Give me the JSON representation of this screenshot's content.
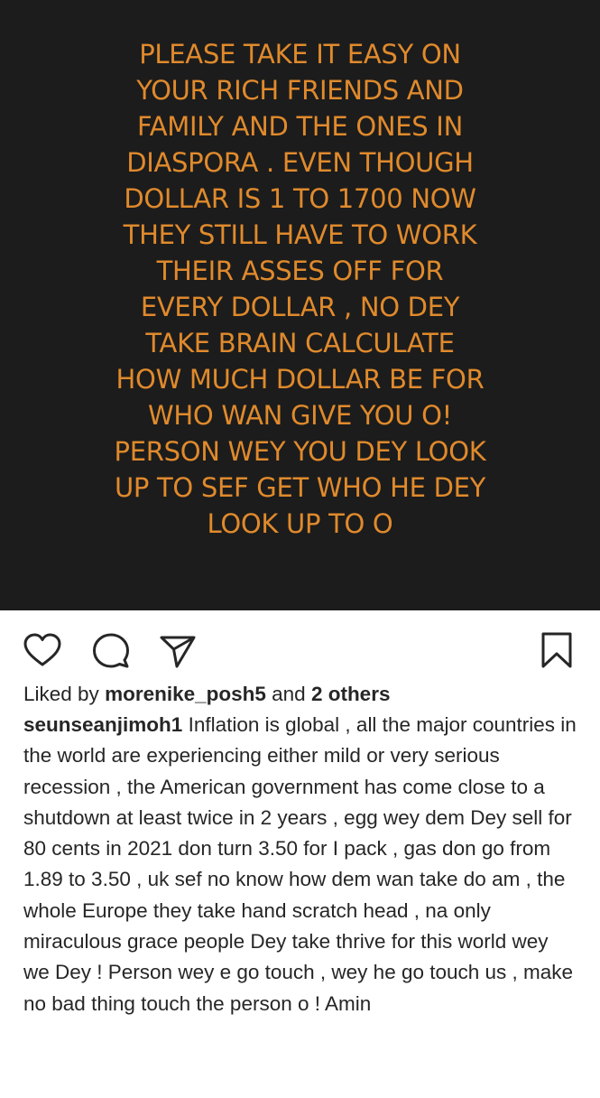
{
  "post": {
    "story_text": "PLEASE TAKE IT EASY ON\nYOUR RICH FRIENDS AND\nFAMILY AND THE ONES IN\nDIASPORA . EVEN THOUGH\nDOLLAR IS 1 TO 1700 NOW\nTHEY STILL HAVE TO WORK\nTHEIR ASSES OFF FOR\nEVERY DOLLAR , NO DEY\nTAKE BRAIN CALCULATE\nHOW MUCH DOLLAR  BE FOR\nWHO WAN GIVE YOU O!\nPERSON WEY YOU DEY LOOK\nUP TO SEF GET WHO HE DEY\nLOOK UP TO O",
    "background_color": "#1c1c1c",
    "text_color": "#e08a2c"
  },
  "actions": {
    "like_icon": "heart-icon",
    "comment_icon": "comment-icon",
    "share_icon": "send-icon",
    "save_icon": "bookmark-icon"
  },
  "likes": {
    "prefix": "Liked by ",
    "user": "morenike_posh5",
    "middle": " and ",
    "others": "2 others"
  },
  "caption": {
    "username": "seunseanjimoh1",
    "text": " Inflation is global , all the major countries in the world are experiencing either mild or very serious recession , the American government has come close to a shutdown at least twice in 2 years , egg wey dem Dey sell for 80 cents in 2021 don turn 3.50 for I pack , gas don go from 1.89 to 3.50 , uk sef no know how dem wan take do am , the whole Europe they take hand scratch head , na only miraculous grace people Dey take thrive for this world wey we Dey ! Person wey e go touch , wey he go touch us , make no bad thing touch the person o ! Amin"
  }
}
